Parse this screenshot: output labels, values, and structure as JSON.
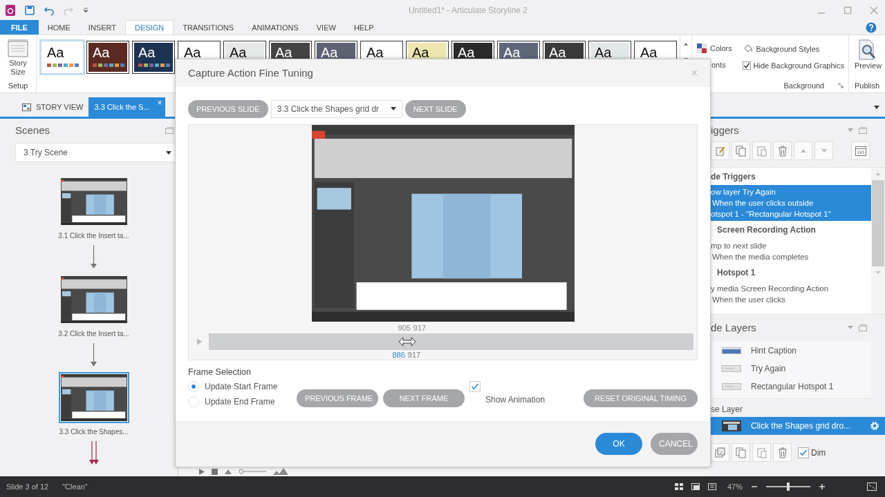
{
  "window": {
    "title": "Untitled1* - Articulate Storyline 2"
  },
  "menu_tabs": [
    {
      "label": "FILE",
      "kind": "file",
      "selected": false
    },
    {
      "label": "HOME",
      "kind": "tab",
      "selected": false
    },
    {
      "label": "INSERT",
      "kind": "tab",
      "selected": false
    },
    {
      "label": "DESIGN",
      "kind": "tab",
      "selected": true
    },
    {
      "label": "TRANSITIONS",
      "kind": "tab",
      "selected": false
    },
    {
      "label": "ANIMATIONS",
      "kind": "tab",
      "selected": false
    },
    {
      "label": "VIEW",
      "kind": "tab",
      "selected": false
    },
    {
      "label": "HELP",
      "kind": "tab",
      "selected": false
    }
  ],
  "ribbon": {
    "story_size": "Story Size",
    "setup_group": "Setup",
    "themes": [
      {
        "label": "Aa",
        "color": "#ffffff",
        "swatches": true,
        "selected": true
      },
      {
        "label": "Aa",
        "color": "#5a2a22",
        "swatches": true,
        "selected": false
      },
      {
        "label": "Aa",
        "color": "#1c3352",
        "swatches": true,
        "selected": false
      },
      {
        "label": "Aa",
        "color": "#ffffff",
        "swatches": false,
        "selected": false
      },
      {
        "label": "Aa",
        "color": "#e6e8e8",
        "swatches": false,
        "selected": false
      },
      {
        "label": "Aa",
        "color": "#444444",
        "swatches": false,
        "selected": false
      },
      {
        "label": "Aa",
        "color": "#5d6274",
        "swatches": false,
        "selected": false
      },
      {
        "label": "Aa",
        "color": "#fdfdfd",
        "swatches": false,
        "selected": false
      },
      {
        "label": "Aa",
        "color": "#eee8b0",
        "swatches": false,
        "selected": false
      },
      {
        "label": "Aa",
        "color": "#2a2a2a",
        "swatches": false,
        "selected": false
      },
      {
        "label": "Aa",
        "color": "#5e6678",
        "swatches": false,
        "selected": false
      },
      {
        "label": "Aa",
        "color": "#3a3a3a",
        "swatches": false,
        "selected": false
      },
      {
        "label": "Aa",
        "color": "#e2e7ea",
        "swatches": false,
        "selected": false
      },
      {
        "label": "Aa",
        "color": "#ffffff",
        "swatches": false,
        "selected": false
      }
    ],
    "colors": "Colors",
    "fonts": "onts",
    "background_styles": "Background Styles",
    "hide_background_graphics": {
      "label": "Hide Background Graphics",
      "checked": true
    },
    "background_group": "Background",
    "preview": "Preview",
    "publish_group": "Publish"
  },
  "doc_tabs": [
    {
      "label": "STORY VIEW",
      "kind": "story",
      "selected": false
    },
    {
      "label": "3.3 Click the S...",
      "kind": "slide",
      "selected": true,
      "close": "×"
    }
  ],
  "scenes": {
    "title": "Scenes",
    "scene": "3 Try Scene",
    "slides": [
      {
        "label": "3.1 Click the Insert ta...",
        "selected": false
      },
      {
        "label": "3.2 Click the Insert ta...",
        "selected": false
      },
      {
        "label": "3.3 Click the Shapes...",
        "selected": true
      }
    ]
  },
  "triggers": {
    "title": "iggers",
    "group": "de Triggers",
    "items": [
      {
        "kind": "trigger",
        "action": "ow layer Try Again",
        "condition": "When the user clicks outside",
        "detail": "otspot 1 - \"Rectangular Hotspot 1\"",
        "selected": true
      },
      {
        "kind": "object",
        "label": "Screen Recording Action"
      },
      {
        "kind": "trigger",
        "action": "mp to next slide",
        "condition": "When the media completes",
        "selected": false
      },
      {
        "kind": "object",
        "label": "Hotspot 1"
      },
      {
        "kind": "trigger",
        "action": "y media Screen Recording Action",
        "condition": "When the user clicks",
        "selected": false
      }
    ]
  },
  "layers": {
    "title": "de Layers",
    "items": [
      {
        "label": "Hint Caption",
        "kind": "caption"
      },
      {
        "label": "Try Again",
        "kind": "plain"
      },
      {
        "label": "Rectangular Hotspot 1",
        "kind": "plain"
      }
    ],
    "base_title": "se Layer",
    "base": {
      "label": "Click the Shapes grid dro...",
      "selected": true
    },
    "dim": {
      "label": "Dim",
      "checked": true
    }
  },
  "status_bar": {
    "slide": "Slide 3 of 12",
    "theme": "\"Clean\"",
    "zoom": "47%",
    "zoom_slider": {
      "level": 0.5
    }
  },
  "dialog": {
    "title": "Capture Action Fine Tuning",
    "close": "×",
    "previous_slide": "PREVIOUS SLIDE",
    "slide": "3.3 Click the Shapes grid dr",
    "next_slide": "NEXT SLIDE",
    "timeline": {
      "top_start": "905",
      "top_end": "917",
      "start": "886",
      "end": "917",
      "handle": {
        "level": 0.41
      }
    },
    "frame_selection": {
      "title": "Frame Selection",
      "options": [
        {
          "label": "Update Start Frame",
          "selected": true
        },
        {
          "label": "Update End Frame",
          "selected": false
        }
      ]
    },
    "previous_frame": "PREVIOUS FRAME",
    "next_frame": "NEXT FRAME",
    "show_animation": {
      "label": "Show Animation",
      "checked": true
    },
    "reset": "RESET ORIGINAL TIMING",
    "ok": "OK",
    "cancel": "CANCEL"
  }
}
